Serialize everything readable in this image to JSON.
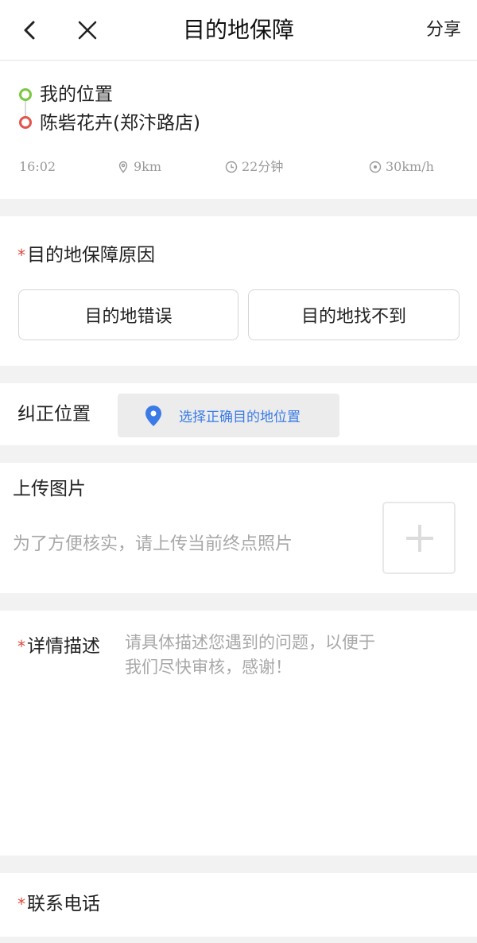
{
  "header": {
    "title": "目的地保障",
    "share_label": "分享"
  },
  "route": {
    "start": "我的位置",
    "end": "陈砦花卉(郑汴路店)",
    "time": "16:02",
    "distance": "9km",
    "duration": "22分钟",
    "speed": "30km/h"
  },
  "reason_section": {
    "label": "目的地保障原因",
    "required_mark": "*",
    "options": [
      "目的地错误",
      "目的地找不到"
    ]
  },
  "correct_section": {
    "label": "纠正位置",
    "button_label": "选择正确目的地位置"
  },
  "upload_section": {
    "label": "上传图片",
    "tip": "为了方便核实，请上传当前终点照片"
  },
  "detail_section": {
    "label": "详情描述",
    "required_mark": "*",
    "placeholder": "请具体描述您遇到的问题，以便于\n我们尽快审核，感谢！"
  },
  "phone_section": {
    "label": "联系电话",
    "required_mark": "*"
  }
}
